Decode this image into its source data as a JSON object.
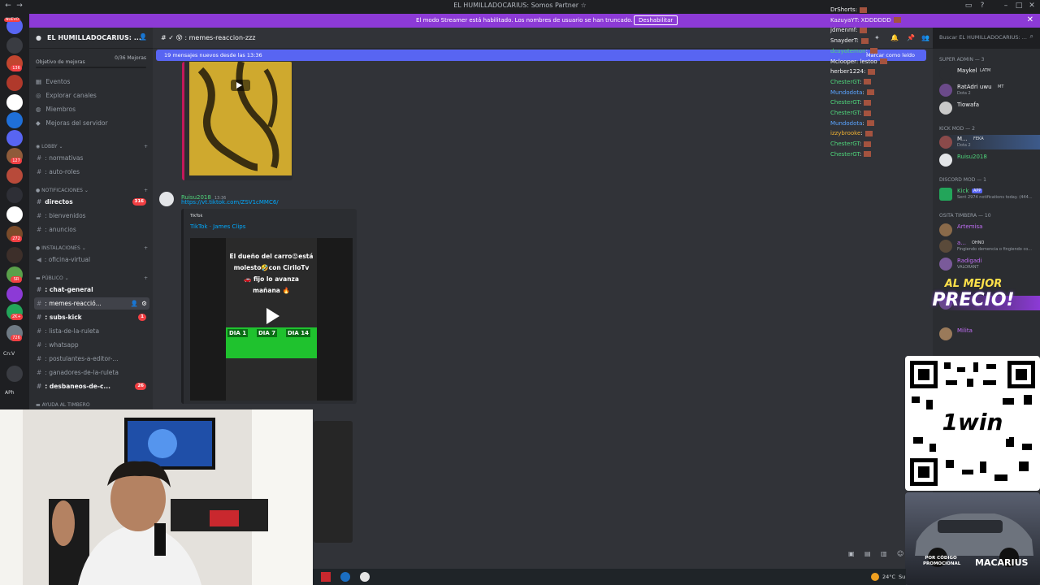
{
  "window": {
    "title": "EL HUMILLADOCARIUS: Somos Partner ☆"
  },
  "banner": {
    "message": "El modo Streamer está habilitado. Los nombres de usuario se han truncado.",
    "button": "Deshabilitar"
  },
  "server_rail": {
    "new_badge": "NUEVO",
    "badges": [
      "136",
      "127",
      "272",
      "SR",
      "2K+",
      "726"
    ],
    "bottom_labels": [
      "Cn:V",
      "APh"
    ]
  },
  "sidebar": {
    "server_name": "EL HUMILLADOCARIUS: ...",
    "goal_label": "Objetivo de mejoras",
    "goal_progress": "0/36 Mejoras",
    "nav": [
      {
        "label": "Eventos",
        "icon": "calendar-icon"
      },
      {
        "label": "Explorar canales",
        "icon": "compass-icon"
      },
      {
        "label": "Miembros",
        "icon": "members-icon"
      },
      {
        "label": "Mejoras del servidor",
        "icon": "boost-icon"
      }
    ],
    "categories": {
      "lobby": "LOBBY",
      "notificaciones": "NOTIFICACIONES",
      "instalaciones": "INSTALACIONES",
      "publico": "PÚBLICO",
      "ayuda": "AYUDA AL TIMBERO"
    },
    "channels": {
      "normativas": ": normativas",
      "auto_roles": ": auto-roles",
      "directos": "directos",
      "directos_badge": "316",
      "bienvenidos": ": bienvenidos",
      "anuncios": ": anuncios",
      "oficina": ": oficina-virtual",
      "chat_general": ": chat-general",
      "memes": ": memes-reacció...",
      "subs_kick": ": subs-kick",
      "subs_badge": "1",
      "lista_ruleta": ": lista-de-la-ruleta",
      "whatsapp": ": whatsapp",
      "postulantes": ": postulantes-a-editor-...",
      "ganadores": ": ganadores-de-la-ruleta",
      "desbaneos": ": desbaneos-de-c...",
      "desbaneos_badge": "26"
    }
  },
  "chat": {
    "channel_name": ": memes-reaccion-zzz",
    "new_messages": "19 mensajes nuevos desde las 13:36",
    "mark_read": "Marcar como leído",
    "message": {
      "author": "Ruisu2018",
      "time": "13:36",
      "link": "https://vt.tiktok.com/ZSV1cMMC6/",
      "embed_provider": "TikTok",
      "embed_title": "TikTok · James Clips",
      "video_caption": "El dueño del carro😡está molesto🤣con CiriloTv 🚗 fijo lo avanza mañana 🔥",
      "day_labels": [
        "DIA 1",
        "DIA 7",
        "DIA 14"
      ]
    },
    "search_placeholder": "Buscar EL HUMILLADOCARIUS: ..."
  },
  "stream_chat": [
    {
      "user": "DrShorts",
      "text": ":",
      "color": "#f2f3f5"
    },
    {
      "user": "KazuyaYT",
      "text": ": XDDDDDD",
      "color": "#f2f3f5"
    },
    {
      "user": "jdmenmf",
      "text": ":",
      "color": "#f2f3f5"
    },
    {
      "user": "SnayderT",
      "text": ":",
      "color": "#f2f3f5"
    },
    {
      "user": "dcoyotemon",
      "text": ":",
      "color": "#4fd67b"
    },
    {
      "user": "Mclooper",
      "text": ": lestoo",
      "color": "#f2f3f5"
    },
    {
      "user": "herber1224",
      "text": ":",
      "color": "#f2f3f5"
    },
    {
      "user": "ChesterGT",
      "text": ":",
      "color": "#4fd67b"
    },
    {
      "user": "Mundodota",
      "text": ":",
      "color": "#5aa4ff"
    },
    {
      "user": "ChesterGT",
      "text": ":",
      "color": "#4fd67b"
    },
    {
      "user": "ChesterGT",
      "text": ":",
      "color": "#4fd67b"
    },
    {
      "user": "Mundodota",
      "text": ":",
      "color": "#5aa4ff"
    },
    {
      "user": "izzybrooke",
      "text": ":",
      "color": "#f0b232"
    },
    {
      "user": "ChesterGT",
      "text": ":",
      "color": "#4fd67b"
    },
    {
      "user": "ChesterGT",
      "text": ":",
      "color": "#4fd67b"
    }
  ],
  "members": {
    "cat_super": "SUPER ADMIN — 3",
    "cat_kick": "KICK MOD — 2",
    "cat_discord": "DISCORD MOD — 1",
    "cat_osita": "OSITA TIMBERA — 10",
    "list": [
      {
        "name": "Maykel",
        "tag": "LATM",
        "sub": "",
        "color": "#f2f3f5"
      },
      {
        "name": "RatAdri uwu",
        "tag": "MT",
        "sub": "Dota 2",
        "color": "#f2f3f5"
      },
      {
        "name": "Tiowafa",
        "tag": "",
        "sub": "",
        "color": "#f2f3f5"
      },
      {
        "name": "M...",
        "tag": "FEKA",
        "sub": "Dota 2",
        "color": "#f2f3f5"
      },
      {
        "name": "Ruisu2018",
        "tag": "",
        "sub": "",
        "color": "#4fd67b"
      },
      {
        "name": "Kick",
        "tag": "APP",
        "sub": "Sent 2974 notifications today. (444...",
        "color": "#4fd67b"
      },
      {
        "name": "Artemisa",
        "tag": "",
        "sub": "",
        "color": "#c06ef5"
      },
      {
        "name": "a...",
        "tag": "OHNO",
        "sub": "Fingiendo demencia o fingiendo co...",
        "color": "#c06ef5"
      },
      {
        "name": "Radigadi",
        "tag": "",
        "sub": "VALORANT",
        "color": "#c06ef5"
      },
      {
        "name": "Milita",
        "tag": "",
        "sub": "",
        "color": "#c06ef5"
      }
    ]
  },
  "promo": {
    "headline_1": "AL MEJOR",
    "headline_2": "PRECIO!",
    "brand": "1win",
    "code_label": "POR CÓDIGO PROMOCIONAL",
    "code": "MACARIUS"
  },
  "taskbar": {
    "weather": "24°C",
    "weather_suffix": "Su"
  },
  "colors": {
    "banner": "#8c3ad6",
    "accent": "#5865f2",
    "mention": "#f23f43",
    "sidebar": "#2b2d31",
    "chat_bg": "#313338"
  }
}
